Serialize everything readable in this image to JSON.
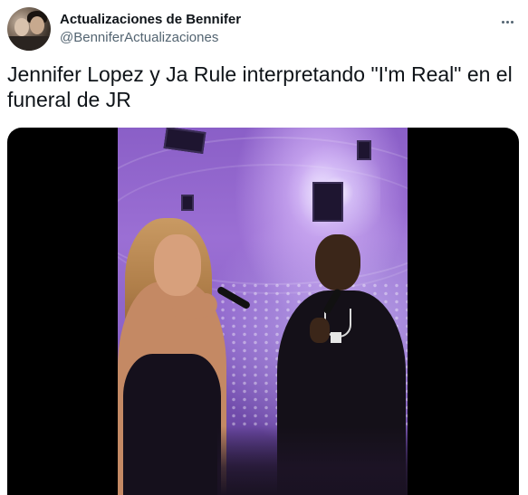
{
  "author": {
    "display_name": "Actualizaciones de Bennifer",
    "handle": "@BenniferActualizaciones",
    "avatar_icon": "profile-photo-avatar"
  },
  "menu": {
    "more_icon": "more-horizontal-icon"
  },
  "tweet": {
    "text": "Jennifer Lopez y Ja Rule interpretando \"I'm Real\" en el funeral de JR"
  },
  "media": {
    "type": "video",
    "description_icon": "video-still"
  },
  "colors": {
    "name_text": "#0f1419",
    "handle_text": "#536471",
    "media_background": "#000000"
  }
}
